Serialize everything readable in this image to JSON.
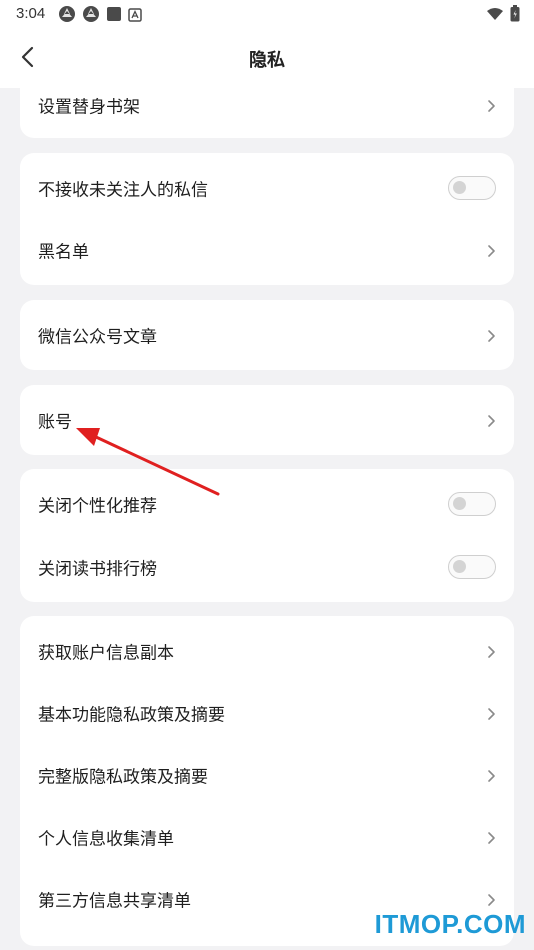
{
  "status_bar": {
    "time": "3:04",
    "left_icons": [
      "aperture-icon",
      "aperture-icon",
      "square-icon",
      "a-badge-icon"
    ],
    "right_icons": [
      "wifi-icon",
      "battery-icon"
    ]
  },
  "header": {
    "title": "隐私",
    "back_icon": "chevron-left-icon"
  },
  "cards": [
    {
      "rows": [
        {
          "label": "设置替身书架",
          "control": "chevron"
        }
      ]
    },
    {
      "rows": [
        {
          "label": "不接收未关注人的私信",
          "control": "toggle",
          "value": false
        },
        {
          "label": "黑名单",
          "control": "chevron"
        }
      ]
    },
    {
      "rows": [
        {
          "label": "微信公众号文章",
          "control": "chevron"
        }
      ]
    },
    {
      "rows": [
        {
          "label": "账号",
          "control": "chevron"
        }
      ]
    },
    {
      "rows": [
        {
          "label": "关闭个性化推荐",
          "control": "toggle",
          "value": false
        },
        {
          "label": "关闭读书排行榜",
          "control": "toggle",
          "value": false
        }
      ]
    },
    {
      "rows": [
        {
          "label": "获取账户信息副本",
          "control": "chevron"
        },
        {
          "label": "基本功能隐私政策及摘要",
          "control": "chevron"
        },
        {
          "label": "完整版隐私政策及摘要",
          "control": "chevron"
        },
        {
          "label": "个人信息收集清单",
          "control": "chevron"
        },
        {
          "label": "第三方信息共享清单",
          "control": "chevron"
        }
      ]
    }
  ],
  "annotation": {
    "arrow_color": "#e02020"
  },
  "watermark": {
    "text": "ITMOP.COM",
    "color": "#1e9ad6"
  }
}
